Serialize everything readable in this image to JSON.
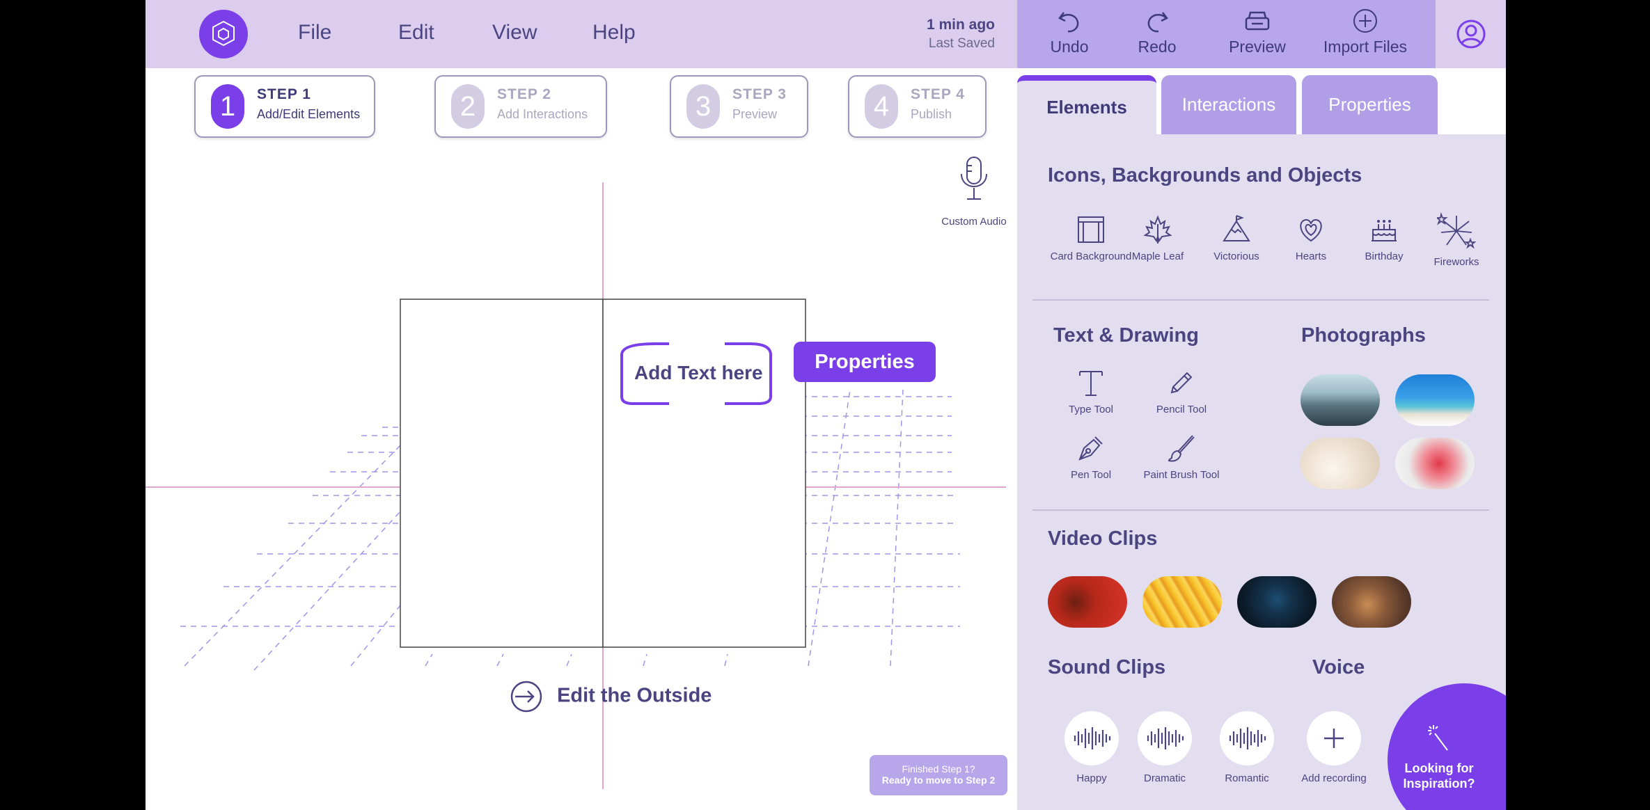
{
  "menu": {
    "file": "File",
    "edit": "Edit",
    "view": "View",
    "help": "Help"
  },
  "save": {
    "time": "1 min ago",
    "label": "Last Saved"
  },
  "toolbar": {
    "undo": "Undo",
    "redo": "Redo",
    "preview": "Preview",
    "import": "Import Files"
  },
  "steps": [
    {
      "num": "1",
      "title": "STEP 1",
      "sub": "Add/Edit Elements"
    },
    {
      "num": "2",
      "title": "STEP 2",
      "sub": "Add Interactions"
    },
    {
      "num": "3",
      "title": "STEP 3",
      "sub": "Preview"
    },
    {
      "num": "4",
      "title": "STEP 4",
      "sub": "Publish"
    }
  ],
  "canvas": {
    "add_text": "Add Text here",
    "properties": "Properties",
    "audio": "Custom Audio",
    "edit_outside": "Edit the Outside",
    "finished_line1": "Finished Step 1?",
    "finished_line2": "Ready to move to Step 2"
  },
  "tabs": {
    "elements": "Elements",
    "interactions": "Interactions",
    "properties": "Properties"
  },
  "sections": {
    "icons": "Icons, Backgrounds and Objects",
    "text": "Text & Drawing",
    "photos": "Photographs",
    "video": "Video Clips",
    "sound": "Sound Clips",
    "voice": "Voice"
  },
  "icons": {
    "card": "Card Background",
    "maple": "Maple Leaf",
    "victorious": "Victorious",
    "hearts": "Hearts",
    "birthday": "Birthday",
    "fireworks": "Fireworks"
  },
  "tools": {
    "type": "Type Tool",
    "pencil": "Pencil Tool",
    "pen": "Pen Tool",
    "brush": "Paint Brush Tool"
  },
  "sounds": {
    "happy": "Happy",
    "dramatic": "Dramatic",
    "romantic": "Romantic",
    "add": "Add recording"
  },
  "inspire": {
    "line1": "Looking for",
    "line2": "Inspiration?"
  },
  "colors": {
    "accent": "#7a3fe8",
    "header": "#dccdee",
    "toolbar": "#b7a6ea",
    "panel": "#e2ddef",
    "text": "#4a4580"
  }
}
